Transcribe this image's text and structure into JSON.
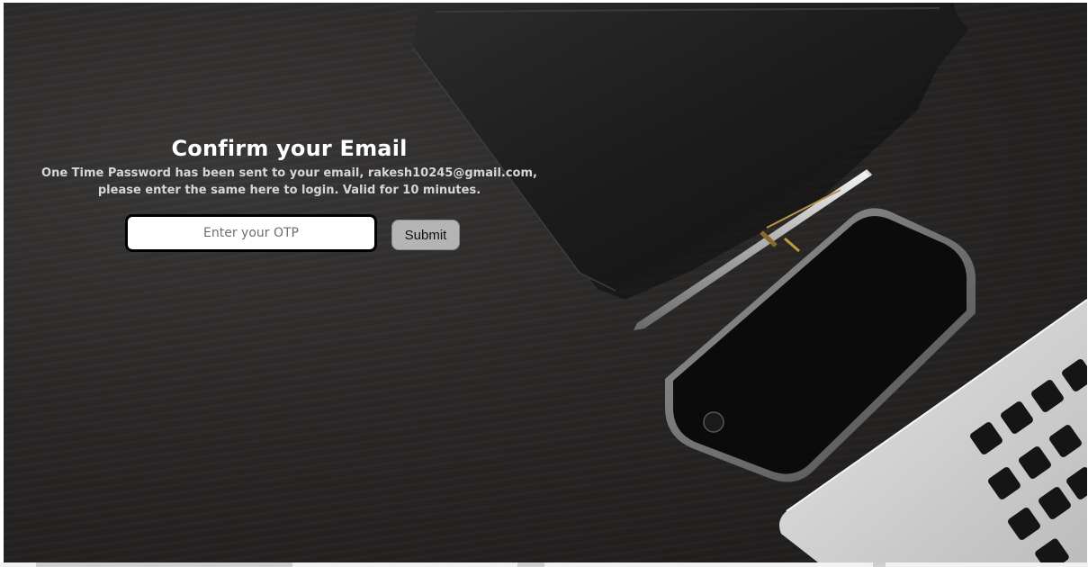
{
  "page": {
    "title": "Confirm your Email",
    "message_line1": "One Time Password has been sent to your email, rakesh10245@gmail.com,",
    "message_line2": "please enter the same here to login. Valid for 10 minutes."
  },
  "form": {
    "otp_value": "",
    "otp_placeholder": "Enter your OTP",
    "submit_label": "Submit"
  },
  "colors": {
    "background": "#2a2827",
    "title_text": "#ffffff",
    "message_text": "#d6d6d6",
    "input_border": "#000000",
    "button_bg": "#b4b4b4"
  }
}
